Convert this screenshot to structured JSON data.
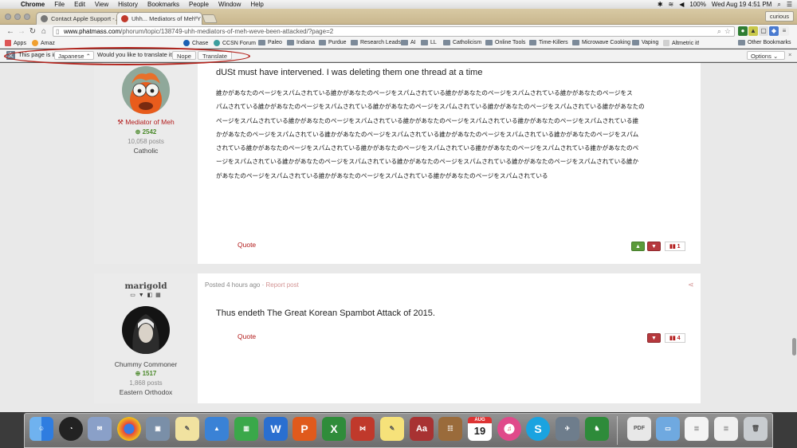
{
  "menubar": {
    "app": "Chrome",
    "items": [
      "File",
      "Edit",
      "View",
      "History",
      "Bookmarks",
      "People",
      "Window",
      "Help"
    ],
    "battery": "100%",
    "datetime": "Wed Aug 19  4:51 PM"
  },
  "tabs": [
    {
      "title": "Contact Apple Support - A",
      "active": false
    },
    {
      "title": "Uhh... Mediators of Meh Y",
      "active": true
    }
  ],
  "profile": "curious",
  "url": {
    "host": "www.phatmass.com",
    "path": "/phorum/topic/138749-uhh-mediators-of-meh-weve-been-attacked/?page=2"
  },
  "bookmarks": {
    "apps": "Apps",
    "items": [
      "Amaz",
      "CCSN Forum",
      "Paleo",
      "Indiana",
      "Purdue",
      "Research Leads",
      "AI",
      "LL",
      "Catholicism",
      "Online Tools",
      "Time-Killers",
      "Microwave Cooking",
      "Vaping",
      "Altmetric it!"
    ],
    "chase": "Chase",
    "other": "Other Bookmarks"
  },
  "translate": {
    "page_is_in": "This page is in",
    "language": "Japanese",
    "question": "Would you like to translate it?",
    "nope": "Nope",
    "translate": "Translate",
    "options": "Options"
  },
  "post1": {
    "rank": "Mediator of Meh",
    "reputation": "2542",
    "posts": "10,058 posts",
    "faith": "Catholic",
    "lead": "dUSt must have intervened. I was deleting them one thread at a time",
    "spam_lines": [
      "誰かがあなたのページをスパムされている誰かがあなたのページをスパムされている誰かがあなたのページをスパムされている誰かがあなたのページをス",
      "パムされている誰かがあなたのページをスパムされている誰かがあなたのページをスパムされている誰かがあなたのページをスパムされている誰かがあなたの",
      "ページをスパムされている誰かがあなたのページをスパムされている誰かがあなたのページをスパムされている誰かがあなたのページをスパムされている誰",
      "かがあなたのページをスパムされている誰かがあなたのページをスパムされている誰かがあなたのページをスパムされている誰かがあなたのページをスパム",
      "されている誰かがあなたのページをスパムされている誰かがあなたのページをスパムされている誰かがあなたのページをスパムされている誰かがあなたのペ",
      "ージをスパムされている誰かがあなたのページをスパムされている誰かがあなたのページをスパムされている誰かがあなたのページをスパムされている誰か",
      "があなたのページをスパムされている誰かがあなたのページをスパムされている誰かがあなたのページをスパムされている"
    ],
    "quote": "Quote",
    "reaction_count": "1"
  },
  "post2": {
    "username": "marigold",
    "rank": "Chummy Commoner",
    "reputation": "1517",
    "posts": "1,868 posts",
    "faith": "Eastern Orthodox",
    "posted": "Posted 4 hours ago",
    "sep": " · ",
    "report": "Report post",
    "body": "Thus endeth The Great Korean Spambot Attack of 2015.",
    "quote": "Quote",
    "reaction_count": "4"
  },
  "dock": {
    "calendar_month": "AUG",
    "calendar_day": "19",
    "pdf_label": "PDF"
  }
}
